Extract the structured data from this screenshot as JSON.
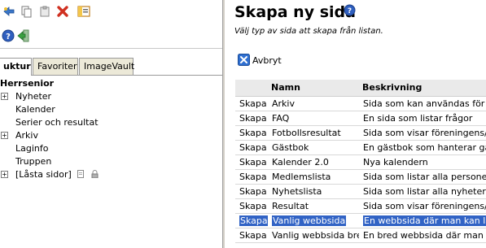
{
  "left_panel": {
    "tabs": [
      {
        "label": "uktur",
        "active": true
      },
      {
        "label": "Favoriter",
        "active": false
      },
      {
        "label": "ImageVault",
        "active": false
      }
    ],
    "tree": {
      "root": "Herrsenior",
      "items": [
        {
          "label": "Nyheter",
          "expandable": true
        },
        {
          "label": "Kalender",
          "expandable": false
        },
        {
          "label": "Serier och resultat",
          "expandable": false
        },
        {
          "label": "Arkiv",
          "expandable": true
        },
        {
          "label": "Laginfo",
          "expandable": false
        },
        {
          "label": "Truppen",
          "expandable": false
        },
        {
          "label": "[Låsta sidor]",
          "expandable": true
        }
      ]
    }
  },
  "right_panel": {
    "title": "Skapa ny sida",
    "subtitle": "Välj typ av sida att skapa från listan.",
    "cancel_label": "Avbryt",
    "table": {
      "headers": [
        "",
        "Namn",
        "Beskrivning"
      ],
      "rows": [
        {
          "action": "Skapa",
          "name": "Arkiv",
          "description": "Sida som kan användas för att v"
        },
        {
          "action": "Skapa",
          "name": "FAQ",
          "description": "En sida som listar frågor"
        },
        {
          "action": "Skapa",
          "name": "Fotbollsresultat",
          "description": "Sida som visar föreningens/lage"
        },
        {
          "action": "Skapa",
          "name": "Gästbok",
          "description": "En gästbok som hanterar gästb"
        },
        {
          "action": "Skapa",
          "name": "Kalender 2.0",
          "description": "Nya kalendern"
        },
        {
          "action": "Skapa",
          "name": "Medlemslista",
          "description": "Sida som listar alla personer so"
        },
        {
          "action": "Skapa",
          "name": "Nyhetslista",
          "description": "Sida som listar alla nyheter i akt"
        },
        {
          "action": "Skapa",
          "name": "Resultat",
          "description": "Sida som visar föreningens/lage"
        },
        {
          "action": "Skapa",
          "name": "Vanlig webbsida",
          "description": "En webbsida där man kan lägga"
        },
        {
          "action": "Skapa",
          "name": "Vanlig webbsida bred",
          "description": "En bred webbsida där man kan"
        }
      ]
    }
  },
  "icons": {
    "toolbar_row1": [
      "new-page-icon",
      "copy-icon",
      "paste-icon",
      "delete-icon",
      "preview-icon"
    ],
    "toolbar_row2": [
      "help-icon",
      "exit-icon"
    ]
  },
  "colors": {
    "selection": "#3163c5",
    "header_bg": "#eaeaea",
    "delete_red": "#d03020",
    "help_blue": "#2f5fbf"
  }
}
